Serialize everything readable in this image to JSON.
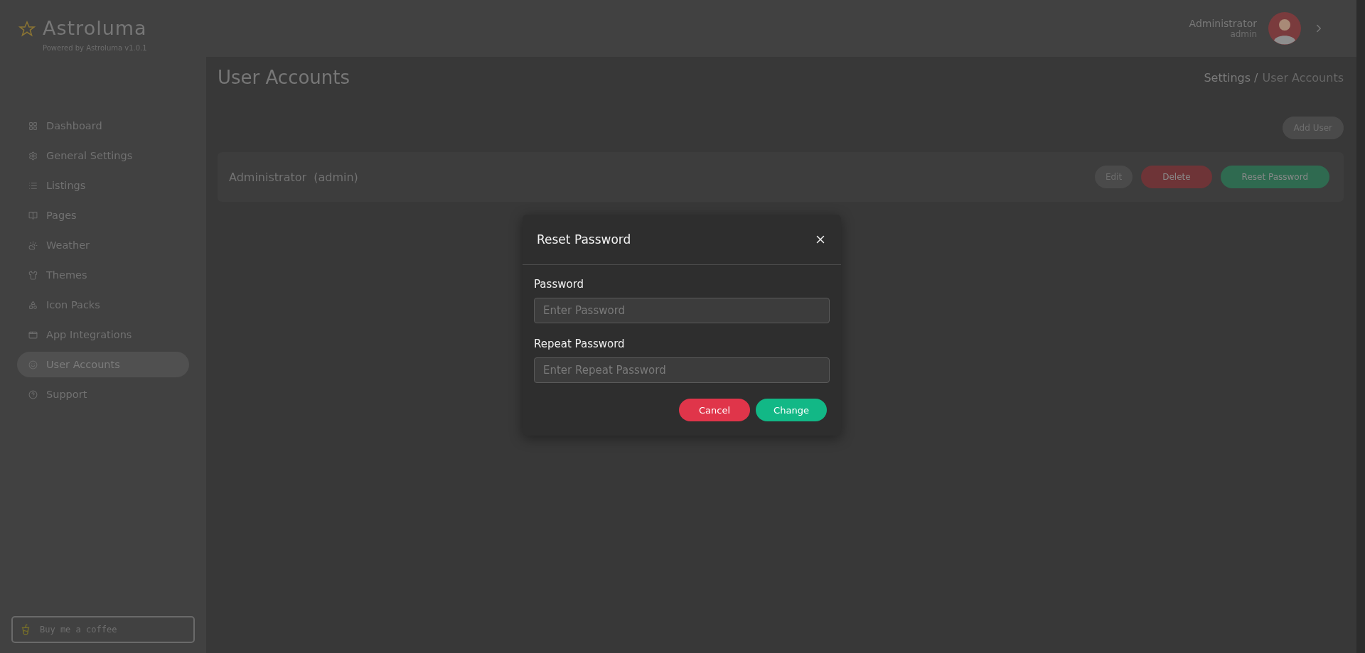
{
  "brand": {
    "name": "Astroluma",
    "tagline": "Powered by Astroluma v1.0.1"
  },
  "sidebar": {
    "items": [
      {
        "label": "Dashboard",
        "selected": false
      },
      {
        "label": "General Settings",
        "selected": false
      },
      {
        "label": "Listings",
        "selected": false
      },
      {
        "label": "Pages",
        "selected": false
      },
      {
        "label": "Weather",
        "selected": false
      },
      {
        "label": "Themes",
        "selected": false
      },
      {
        "label": "Icon Packs",
        "selected": false
      },
      {
        "label": "App Integrations",
        "selected": false
      },
      {
        "label": "User Accounts",
        "selected": true
      },
      {
        "label": "Support",
        "selected": false
      }
    ],
    "coffee_link": "Buy me a coffee"
  },
  "user": {
    "name": "Administrator",
    "username": "admin"
  },
  "page": {
    "title": "User Accounts",
    "breadcrumb": [
      "Settings /",
      "User Accounts"
    ],
    "add_button": "Add User"
  },
  "accounts": [
    {
      "name": "Administrator",
      "username": "(admin)",
      "actions": [
        {
          "label": "Edit",
          "kind": "neutral"
        },
        {
          "label": "Delete",
          "kind": "danger"
        },
        {
          "label": "Reset Password",
          "kind": "success"
        }
      ]
    }
  ],
  "modal": {
    "title": "Reset Password",
    "fields": [
      {
        "label": "Password",
        "placeholder": "Enter Password"
      },
      {
        "label": "Repeat Password",
        "placeholder": "Enter Repeat Password"
      }
    ],
    "buttons": [
      {
        "label": "Cancel",
        "kind": "danger"
      },
      {
        "label": "Change",
        "kind": "success"
      }
    ]
  }
}
